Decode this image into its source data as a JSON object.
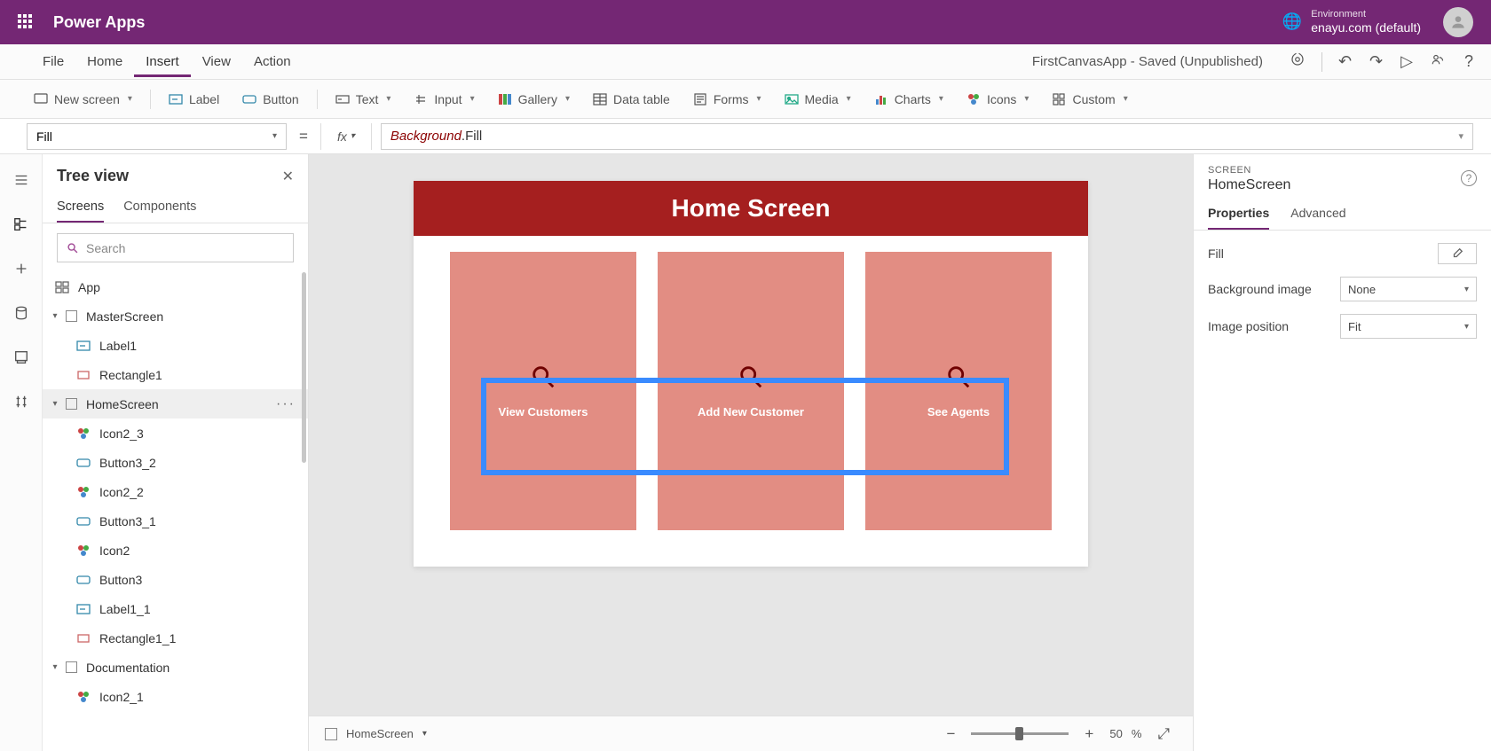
{
  "header": {
    "title": "Power Apps",
    "env_label": "Environment",
    "env_value": "enayu.com (default)"
  },
  "menu": {
    "items": [
      "File",
      "Home",
      "Insert",
      "View",
      "Action"
    ],
    "active_index": 2,
    "app_status": "FirstCanvasApp - Saved (Unpublished)"
  },
  "ribbon": {
    "new_screen": "New screen",
    "label": "Label",
    "button": "Button",
    "text": "Text",
    "input": "Input",
    "gallery": "Gallery",
    "data_table": "Data table",
    "forms": "Forms",
    "media": "Media",
    "charts": "Charts",
    "icons": "Icons",
    "custom": "Custom"
  },
  "formula": {
    "prop": "Fill",
    "fx": "fx",
    "part1": "Background",
    "part2": ".Fill"
  },
  "tree_panel": {
    "title": "Tree view",
    "tabs": [
      "Screens",
      "Components"
    ],
    "active_tab": 0,
    "search_placeholder": "Search",
    "nodes": {
      "app": "App",
      "master": "MasterScreen",
      "label1": "Label1",
      "rect1": "Rectangle1",
      "home": "HomeScreen",
      "icon2_3": "Icon2_3",
      "button3_2": "Button3_2",
      "icon2_2": "Icon2_2",
      "button3_1": "Button3_1",
      "icon2": "Icon2",
      "button3": "Button3",
      "label1_1": "Label1_1",
      "rect1_1": "Rectangle1_1",
      "doc": "Documentation",
      "icon2_1": "Icon2_1"
    }
  },
  "canvas": {
    "title": "Home Screen",
    "cards": [
      {
        "caption": "View Customers"
      },
      {
        "caption": "Add New Customer"
      },
      {
        "caption": "See Agents"
      }
    ],
    "footer_label": "HomeScreen",
    "zoom_pct": "50",
    "zoom_unit": "%"
  },
  "props": {
    "kicker": "SCREEN",
    "name": "HomeScreen",
    "tabs": [
      "Properties",
      "Advanced"
    ],
    "active_tab": 0,
    "rows": {
      "fill": "Fill",
      "bg_image": "Background image",
      "bg_image_val": "None",
      "img_pos": "Image position",
      "img_pos_val": "Fit"
    }
  }
}
